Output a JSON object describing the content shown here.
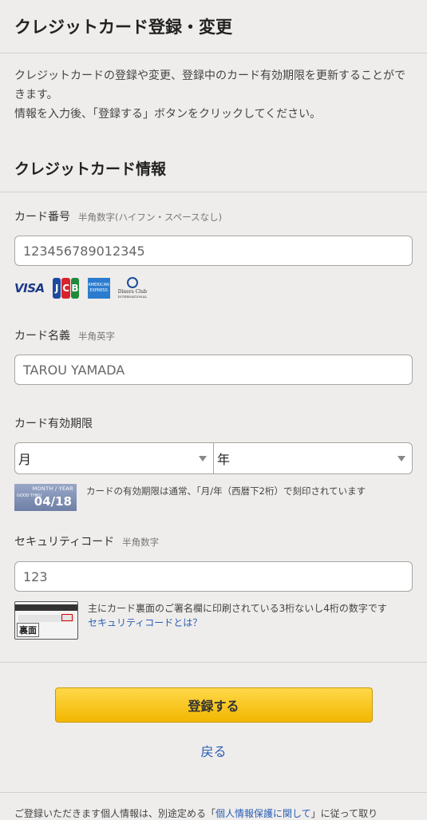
{
  "header": {
    "title": "クレジットカード登録・変更"
  },
  "intro": {
    "line1": "クレジットカードの登録や変更、登録中のカード有効期限を更新することができます。",
    "line2": "情報を入力後、「登録する」ボタンをクリックしてください。"
  },
  "section": {
    "title": "クレジットカード情報"
  },
  "card_number": {
    "label": "カード番号",
    "hint": "半角数字(ハイフン・スペースなし)",
    "value": "123456789012345"
  },
  "card_brands": {
    "visa": "VISA",
    "jcb": [
      "J",
      "C",
      "B"
    ],
    "amex": "AMERICAN EXPRESS",
    "diners": "Diners Club",
    "diners_sub": "INTERNATIONAL"
  },
  "card_name": {
    "label": "カード名義",
    "hint": "半角英字",
    "value": "TAROU YAMADA"
  },
  "expiry": {
    "label": "カード有効期限",
    "month": "月",
    "year": "年",
    "image_top": "MONTH / YEAR",
    "image_small": "GOOD THRU",
    "image_value": "04/18",
    "note": "カードの有効期限は通常、「月/年（西暦下2桁）で刻印されています"
  },
  "security": {
    "label": "セキュリティコード",
    "hint": "半角数字",
    "value": "123",
    "image_label": "裏面",
    "note": "主にカード裏面のご署名欄に印刷されている3桁ないし4桁の数字です",
    "link": "セキュリティコードとは？"
  },
  "actions": {
    "submit": "登録する",
    "back": "戻る"
  },
  "footer": {
    "before": "ご登録いただきます個人情報は、別途定める「",
    "link": "個人情報保護に関して",
    "after": "」に従って取り"
  },
  "colors": {
    "accent": "#f2b700",
    "link": "#2a5db5",
    "background": "#efedeb"
  }
}
